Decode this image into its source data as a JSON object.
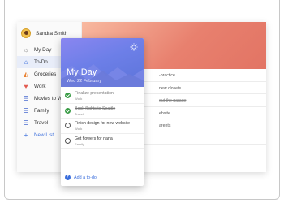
{
  "user": {
    "name": "Sandra Smith"
  },
  "nav": [
    {
      "label": "My Day",
      "icon": "sun-icon",
      "active": false
    },
    {
      "label": "To-Do",
      "icon": "home-icon",
      "active": true
    },
    {
      "label": "Groceries",
      "icon": "pizza-icon",
      "active": false
    },
    {
      "label": "Work",
      "icon": "heart-icon",
      "active": false
    },
    {
      "label": "Movies to Wat",
      "icon": "list-icon",
      "active": false
    },
    {
      "label": "Family",
      "icon": "list-icon",
      "active": false
    },
    {
      "label": "Travel",
      "icon": "list-icon",
      "active": false
    },
    {
      "label": "New List",
      "icon": "plus-icon",
      "active": false
    }
  ],
  "back_list": [
    {
      "text": "-practice",
      "strike": false
    },
    {
      "text": "new closets",
      "strike": false
    },
    {
      "text": "out the garage",
      "strike": true
    },
    {
      "text": "ebsite",
      "strike": false
    },
    {
      "text": "arents",
      "strike": false
    },
    {
      "text": "",
      "strike": false
    }
  ],
  "my_day": {
    "title": "My Day",
    "date": "Wed 22 February",
    "tasks": [
      {
        "title": "Finalize presentation",
        "list": "Work",
        "done": true
      },
      {
        "title": "Book flights to Seattle",
        "list": "Travel",
        "done": true
      },
      {
        "title": "Finish design for new website",
        "list": "Work",
        "done": false
      },
      {
        "title": "Get flowers for nana",
        "list": "Family",
        "done": false
      }
    ],
    "add_label": "Add a to-do"
  },
  "colors": {
    "accent": "#3b6edc",
    "done_check": "#3a9c46",
    "header_purple": "#6d7fe8",
    "header_coral": "#e8806e"
  }
}
